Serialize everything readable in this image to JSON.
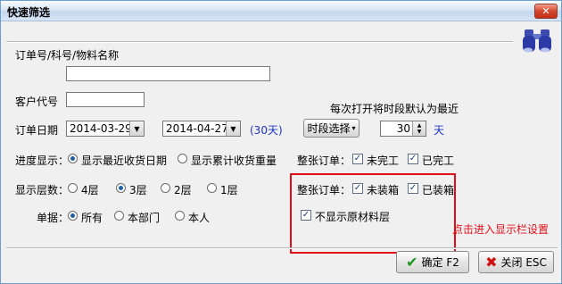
{
  "window": {
    "title": "快速筛选",
    "close_glyph": "✕"
  },
  "icons": {
    "binoculars": "binoculars-icon",
    "close": "close-icon",
    "ok": "checkmark-icon",
    "cancel": "x-icon"
  },
  "order_field": {
    "label": "订单号/科号/物料名称",
    "value": ""
  },
  "customer": {
    "label": "客户代号",
    "value": ""
  },
  "date": {
    "label": "订单日期",
    "start": "2014-03-29",
    "end": "2014-04-27",
    "days": "(30天)",
    "period_button": "时段选择",
    "default_hint": "每次打开将时段默认为最近",
    "recent_value": "30",
    "unit": "天"
  },
  "progress": {
    "label": "进度显示：",
    "options": [
      "显示最近收货日期",
      "显示累计收货重量"
    ],
    "selected": 0
  },
  "layers": {
    "label": "显示层数：",
    "options": [
      "4层",
      "3层",
      "2层",
      "1层"
    ],
    "selected": 1
  },
  "doc": {
    "label": "单据：",
    "options": [
      "所有",
      "本部门",
      "本人"
    ],
    "selected": 0
  },
  "whole_order_1": {
    "label": "整张订单：",
    "opt1": "未完工",
    "opt2": "已完工",
    "opt1_checked": true,
    "opt2_checked": true
  },
  "whole_order_2": {
    "label": "整张订单：",
    "opt1": "未装箱",
    "opt2": "已装箱",
    "opt1_checked": true,
    "opt2_checked": true
  },
  "no_raw": {
    "label": "不显示原材料层",
    "checked": true
  },
  "hint": "点击进入显示栏设置",
  "buttons": {
    "ok": "确定 F2",
    "close": "关闭 ESC"
  },
  "colors": {
    "highlight_box": "#e0101a",
    "hint_text": "#e0101a",
    "days_text": "#1d34c8"
  }
}
